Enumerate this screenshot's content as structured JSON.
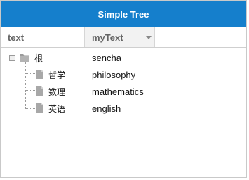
{
  "panel": {
    "title": "Simple Tree"
  },
  "columns": {
    "text": "text",
    "mytext": "myText"
  },
  "rows": [
    {
      "text": "根",
      "mytext": "sencha",
      "icon": "folder-icon"
    },
    {
      "text": "哲学",
      "mytext": "philosophy",
      "icon": "file-icon"
    },
    {
      "text": "数理",
      "mytext": "mathematics",
      "icon": "file-icon"
    },
    {
      "text": "英语",
      "mytext": "english",
      "icon": "file-icon"
    }
  ],
  "colors": {
    "header": "#157fcc",
    "headerText": "#ffffff"
  }
}
